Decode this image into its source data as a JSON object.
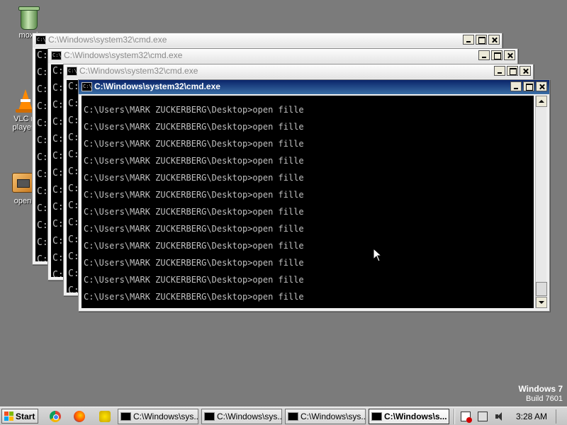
{
  "desktop": {
    "icons": [
      {
        "label": "moxd"
      },
      {
        "label": "VLC m"
      },
      {
        "label": "player -"
      },
      {
        "label": "open"
      }
    ],
    "watermark": {
      "os": "Windows 7",
      "build": "Build 7601"
    }
  },
  "windows": [
    {
      "title": "C:\\Windows\\system32\\cmd.exe",
      "visible_prompt": "C:"
    },
    {
      "title": "C:\\Windows\\system32\\cmd.exe",
      "visible_prompt": "C:"
    },
    {
      "title": "C:\\Windows\\system32\\cmd.exe",
      "visible_prompt": "C:"
    },
    {
      "title": "C:\\Windows\\system32\\cmd.exe",
      "lines": [
        "C:\\Users\\MARK ZUCKERBERG\\Desktop>open fille",
        "C:\\Users\\MARK ZUCKERBERG\\Desktop>open fille",
        "C:\\Users\\MARK ZUCKERBERG\\Desktop>open fille",
        "C:\\Users\\MARK ZUCKERBERG\\Desktop>open fille",
        "C:\\Users\\MARK ZUCKERBERG\\Desktop>open fille",
        "C:\\Users\\MARK ZUCKERBERG\\Desktop>open fille",
        "C:\\Users\\MARK ZUCKERBERG\\Desktop>open fille",
        "C:\\Users\\MARK ZUCKERBERG\\Desktop>open fille",
        "C:\\Users\\MARK ZUCKERBERG\\Desktop>open fille",
        "C:\\Users\\MARK ZUCKERBERG\\Desktop>open fille",
        "C:\\Users\\MARK ZUCKERBERG\\Desktop>open fille",
        "C:\\Users\\MARK ZUCKERBERG\\Desktop>open fille"
      ]
    }
  ],
  "taskbar": {
    "start_label": "Start",
    "quick_launch": [
      {
        "icon": "chrome-icon"
      },
      {
        "icon": "firefox-icon"
      },
      {
        "icon": "media-icon"
      }
    ],
    "tasks": [
      {
        "label": "C:\\Windows\\sys..."
      },
      {
        "label": "C:\\Windows\\sys..."
      },
      {
        "label": "C:\\Windows\\sys..."
      },
      {
        "label": "C:\\Windows\\s..."
      }
    ],
    "tray": {
      "icons": [
        "action-center-icon",
        "network-icon",
        "volume-icon"
      ],
      "clock": "3:28 AM"
    }
  },
  "colors": {
    "desktop_bg": "#7b7b7b",
    "console_bg": "#000000",
    "console_text": "#c0c0c0",
    "active_title": "#0a246a"
  }
}
